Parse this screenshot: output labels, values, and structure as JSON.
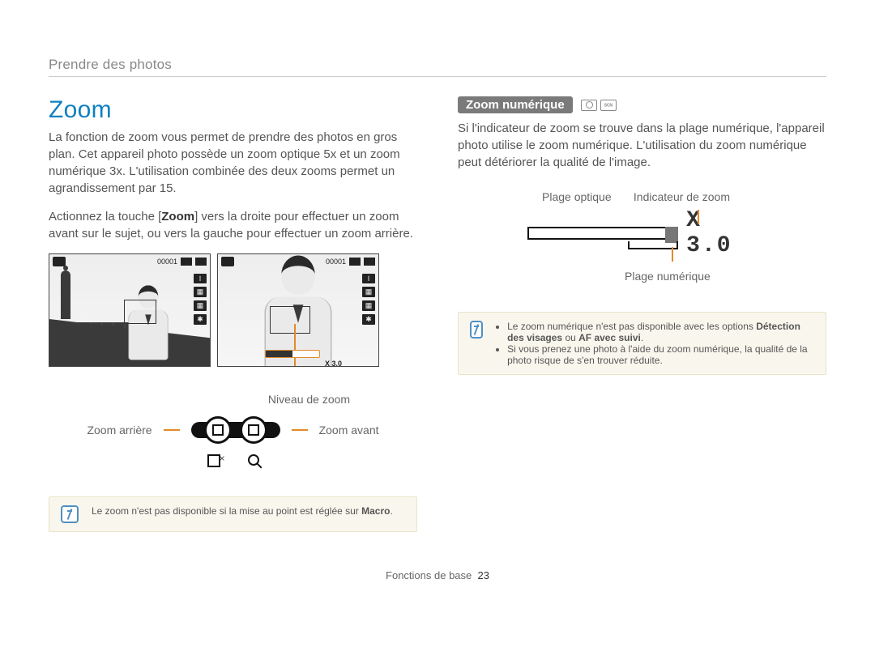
{
  "pre_header": "Prendre des photos",
  "left": {
    "title": "Zoom",
    "p1": "La fonction de zoom vous permet de prendre des photos en gros plan. Cet appareil photo possède un zoom optique 5x et un zoom numérique 3x. L'utilisation combinée des deux zooms permet un agrandissement par 15.",
    "p2_a": "Actionnez la touche [",
    "p2_b": "Zoom",
    "p2_c": "] vers la droite pour effectuer un zoom avant sur le sujet, ou vers la gauche pour effectuer un zoom arrière.",
    "screens": {
      "counter": "00001",
      "zoom_bar_value": "X 3.0"
    },
    "niveau_label": "Niveau de zoom",
    "zoom_out_label": "Zoom arrière",
    "zoom_in_label": "Zoom avant",
    "note_text_a": "Le zoom n'est pas disponible si la mise au point est réglée sur ",
    "note_text_b": "Macro",
    "note_text_c": "."
  },
  "right": {
    "sub_header": "Zoom numérique",
    "p1": "Si l'indicateur de zoom se trouve dans la plage numérique, l'appareil photo utilise le zoom numérique. L'utilisation du zoom numérique peut détériorer la qualité de l'image.",
    "labels": {
      "plage_optique": "Plage optique",
      "indicateur": "Indicateur de zoom",
      "plage_numerique": "Plage numérique",
      "zoom_value": "X 3.0"
    },
    "note_bullet1_a": "Le zoom numérique n'est pas disponible avec les options ",
    "note_bullet1_b": "Détection des visages",
    "note_bullet1_c": " ou ",
    "note_bullet1_d": "AF avec suivi",
    "note_bullet1_e": ".",
    "note_bullet2": "Si vous prenez une photo à l'aide du zoom numérique, la qualité de la photo risque de s'en trouver réduite."
  },
  "footer": {
    "section": "Fonctions de base",
    "page": "23"
  }
}
